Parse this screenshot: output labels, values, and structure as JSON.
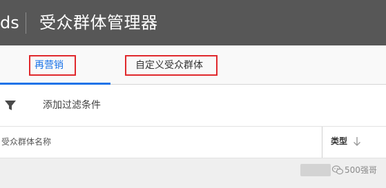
{
  "header": {
    "brand_partial": "ds",
    "title": "受众群体管理器",
    "background": "#575757"
  },
  "tabs": [
    {
      "label": "再营销",
      "active": true,
      "accent": "#1a73e8"
    },
    {
      "label": "自定义受众群体",
      "active": false
    }
  ],
  "annotation": {
    "highlight_color": "#e0282c"
  },
  "filter": {
    "icon": "funnel-icon",
    "label": "添加过滤条件"
  },
  "table": {
    "columns": [
      {
        "label": "受众群体名称"
      },
      {
        "label": "类型",
        "sort_icon": "arrow-down-icon"
      }
    ]
  },
  "watermark": {
    "text": "500强哥"
  }
}
